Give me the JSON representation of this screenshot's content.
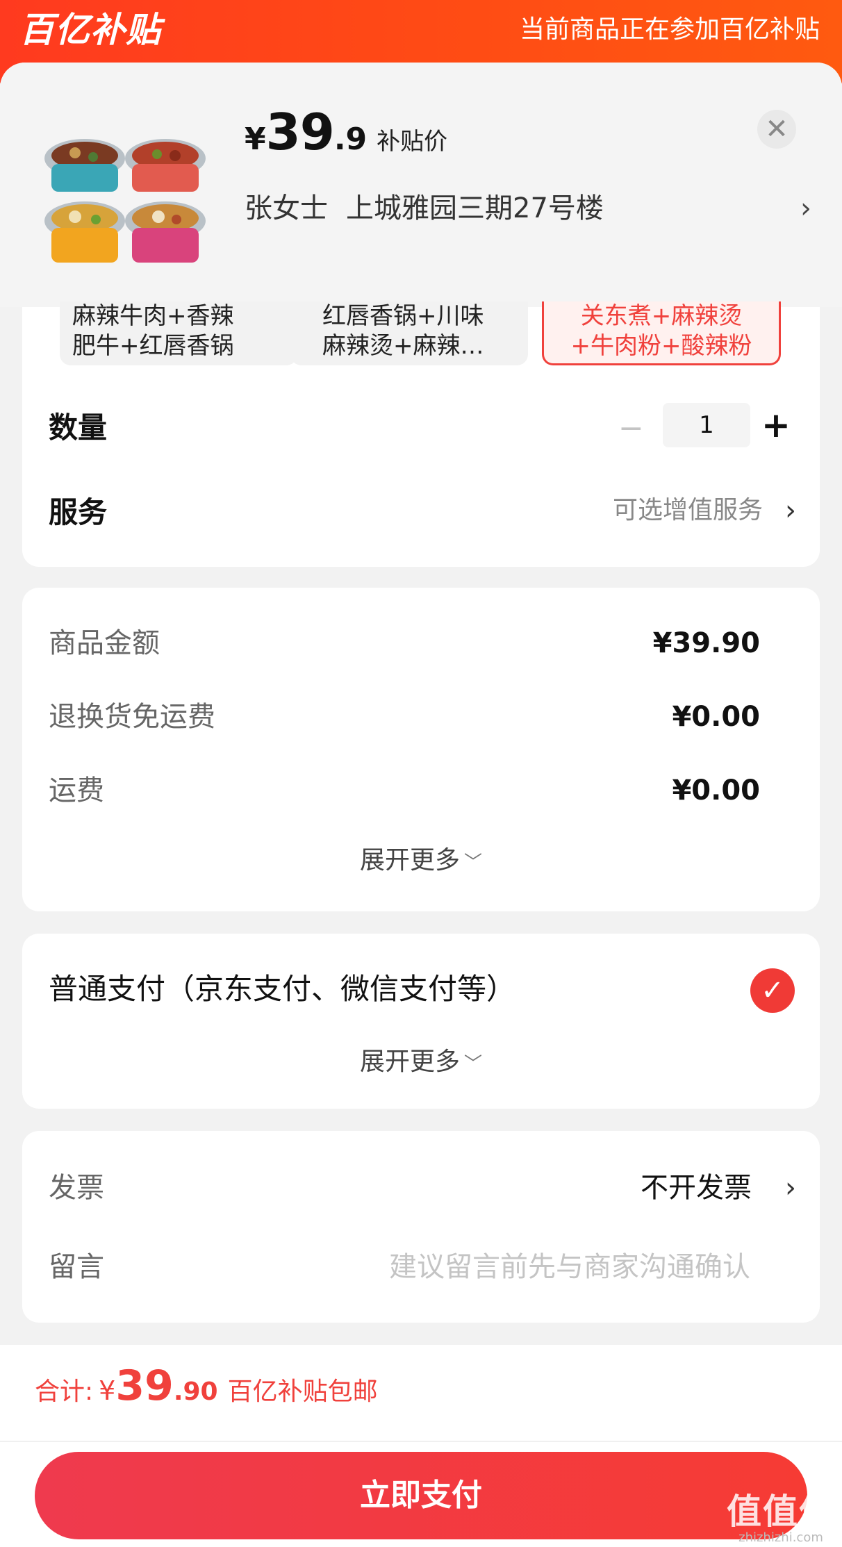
{
  "banner": {
    "logo": "百亿补贴",
    "note": "当前商品正在参加百亿补贴"
  },
  "product": {
    "price_symbol": "¥",
    "price_int": "39",
    "price_dec": ".9",
    "price_tag": "补贴价",
    "recipient": "张女士",
    "address": "上城雅园三期27号楼",
    "close_icon": "close-icon",
    "address_chevron": "chevron-right-icon"
  },
  "variants": [
    {
      "line1": "麻辣牛肉+香辣",
      "line2": "肥牛+红唇香锅",
      "selected": false
    },
    {
      "line1": "红唇香锅+川味",
      "line2": "麻辣烫+麻辣…",
      "selected": false
    },
    {
      "line1": "关东煮+麻辣烫",
      "line2": "+牛肉粉+酸辣粉",
      "selected": true
    }
  ],
  "quantity": {
    "label": "数量",
    "minus": "−",
    "value": "1",
    "plus": "+"
  },
  "service": {
    "label": "服务",
    "value": "可选增值服务",
    "chevron": "›"
  },
  "amounts": {
    "rows": [
      {
        "label": "商品金额",
        "value": "¥39.90"
      },
      {
        "label": "退换货免运费",
        "value": "¥0.00"
      },
      {
        "label": "运费",
        "value": "¥0.00"
      }
    ],
    "expand": "展开更多"
  },
  "payment": {
    "label": "普通支付（京东支付、微信支付等）",
    "check": "✓",
    "expand": "展开更多"
  },
  "invoice": {
    "label": "发票",
    "value": "不开发票",
    "chevron": "›"
  },
  "message": {
    "label": "留言",
    "placeholder": "建议留言前先与商家沟通确认"
  },
  "total": {
    "label": "合计:",
    "symbol": "¥",
    "int": "39",
    "dec": ".90",
    "note": "百亿补贴包邮"
  },
  "pay_button": "立即支付",
  "watermark": {
    "big": "值值值",
    "small": "zhizhizhi.com"
  },
  "colors": {
    "brand_red": "#f0413c",
    "banner_orange": "#ff4a15"
  }
}
